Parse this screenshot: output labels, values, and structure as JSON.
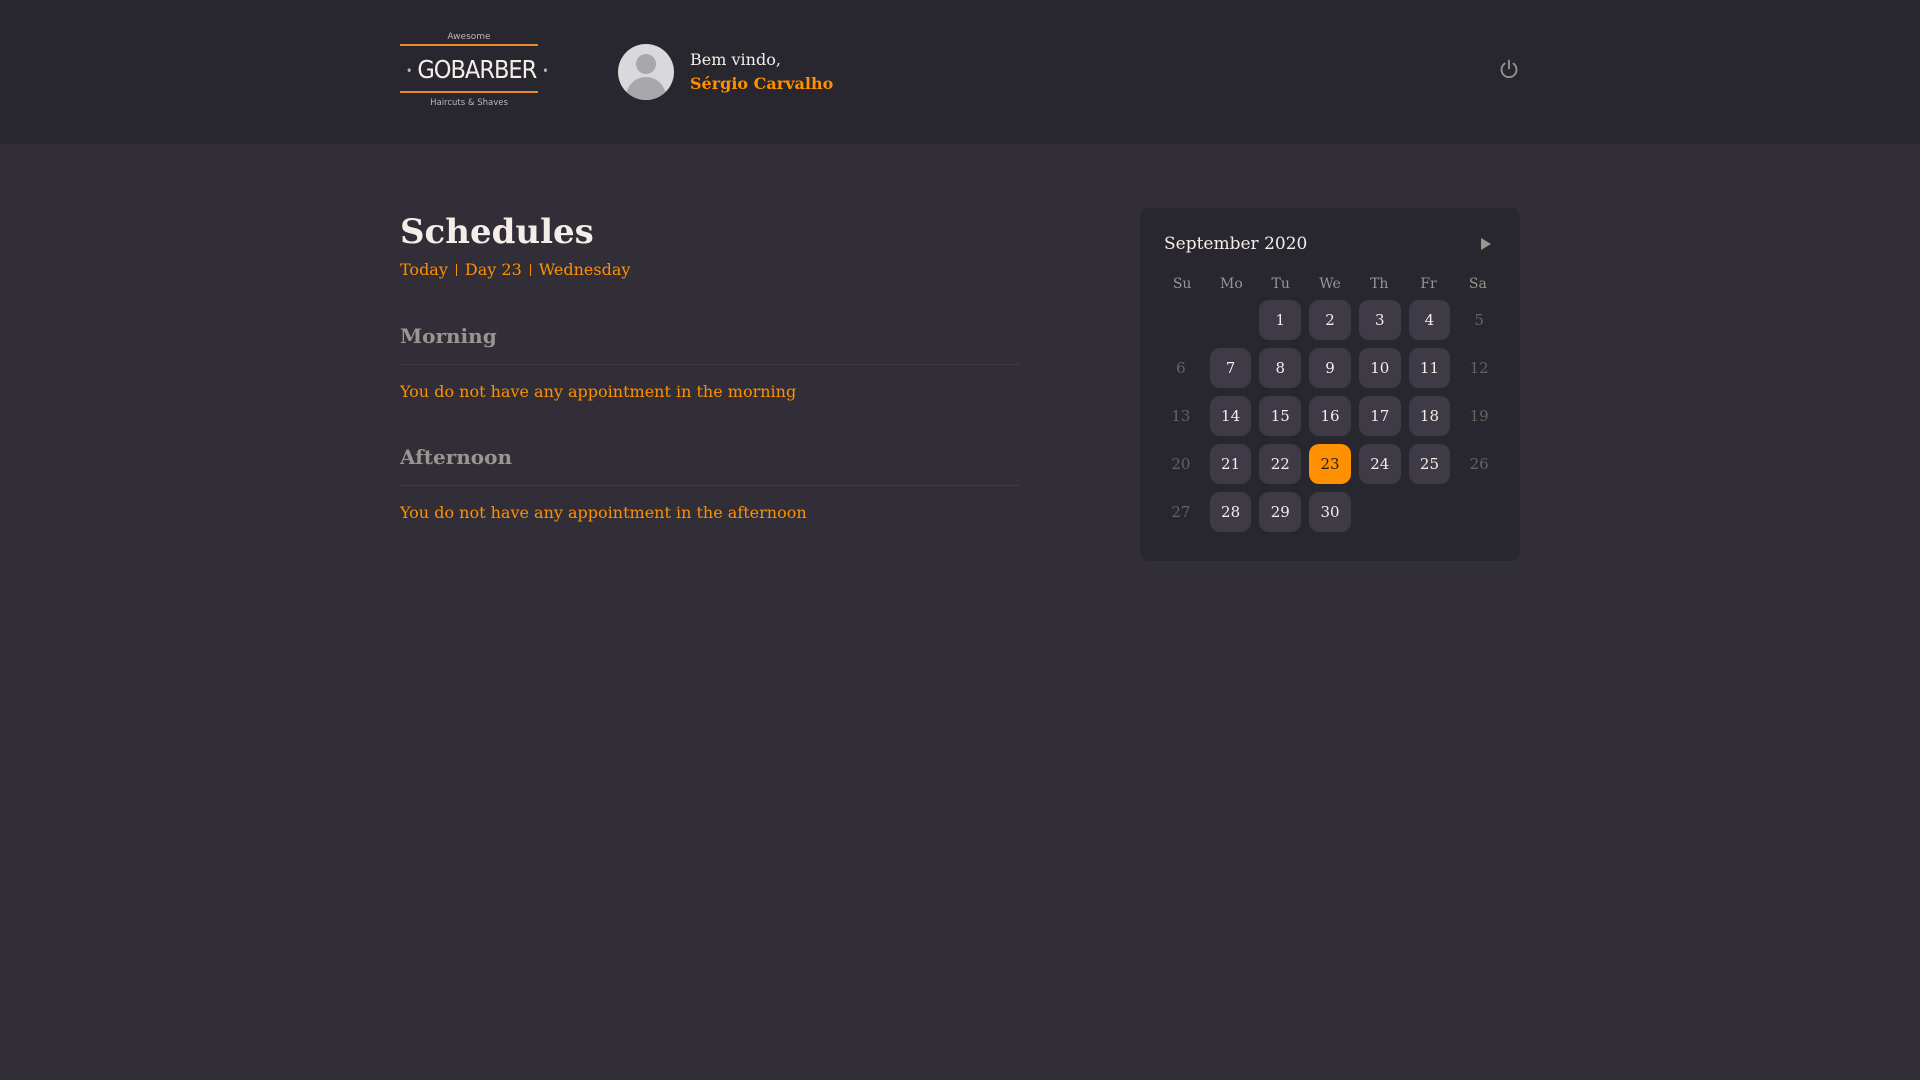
{
  "header": {
    "logo": {
      "top": "Awesome",
      "main": "GOBARBER",
      "bottom": "Haircuts & Shaves"
    },
    "welcome": "Bem vindo,",
    "username": "Sérgio Carvalho",
    "power_icon": "power-icon"
  },
  "schedule": {
    "title": "Schedules",
    "today": "Today",
    "day": "Day 23",
    "weekday": "Wednesday",
    "morning": {
      "title": "Morning",
      "empty": "You do not have any appointment in the morning"
    },
    "afternoon": {
      "title": "Afternoon",
      "empty": "You do not have any appointment in the afternoon"
    }
  },
  "calendar": {
    "month": "September 2020",
    "next_icon": "triangle-right-icon",
    "weekdays": [
      "Su",
      "Mo",
      "Tu",
      "We",
      "Th",
      "Fr",
      "Sa"
    ],
    "selected_day": "23",
    "weeks": [
      [
        "",
        "",
        "1",
        "2",
        "3",
        "4",
        "5"
      ],
      [
        "6",
        "7",
        "8",
        "9",
        "10",
        "11",
        "12"
      ],
      [
        "13",
        "14",
        "15",
        "16",
        "17",
        "18",
        "19"
      ],
      [
        "20",
        "21",
        "22",
        "23",
        "24",
        "25",
        "26"
      ],
      [
        "27",
        "28",
        "29",
        "30",
        "",
        "",
        ""
      ]
    ]
  },
  "colors": {
    "background": "#312e38",
    "header": "#28262e",
    "accent": "#ff9000",
    "day_available": "#3e3b47",
    "muted": "#999591"
  }
}
